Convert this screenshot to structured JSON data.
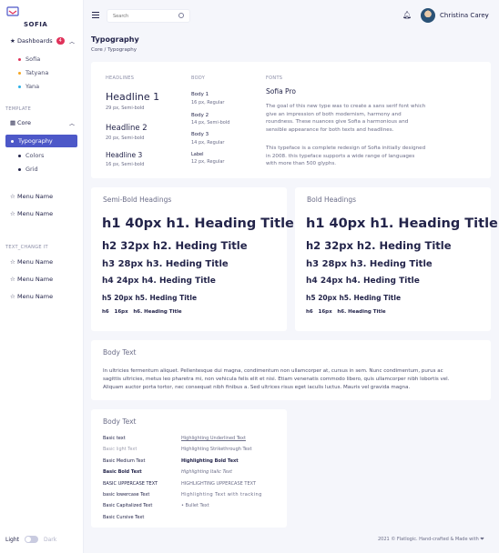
{
  "sidebar": {
    "brand": "SOFIA",
    "dashboards": {
      "label": "Dashboards",
      "badge": "4"
    },
    "dash_items": [
      {
        "label": "Sofia",
        "color": "#e0325a"
      },
      {
        "label": "Tatyana",
        "color": "#f5a623"
      },
      {
        "label": "Yana",
        "color": "#2ab0e8"
      }
    ],
    "template_title": "TEMPLATE",
    "core": {
      "label": "Core"
    },
    "core_items": [
      "Typography",
      "Colors",
      "Grid"
    ],
    "menu_items_a": [
      "Menu Name",
      "Menu Name"
    ],
    "text_change_title": "TEXT_CHANGE IT",
    "menu_items_b": [
      "Menu Name",
      "Menu Name",
      "Menu Name"
    ],
    "theme": {
      "light": "Light",
      "dark": "Dark"
    }
  },
  "header": {
    "search_placeholder": "Search",
    "user_name": "Christina Carey"
  },
  "page": {
    "title": "Typography",
    "breadcrumb": "Core  /  Typography"
  },
  "fonts_card": {
    "headlines_label": "HEADLINES",
    "body_label": "BODY",
    "fonts_label": "FONTS",
    "headlines": [
      {
        "name": "Headline 1",
        "meta": "29 px, Semi-bold"
      },
      {
        "name": "Headline 2",
        "meta": "20 px, Semi-bold"
      },
      {
        "name": "Headline 3",
        "meta": "16 px, Semi-bold"
      }
    ],
    "bodies": [
      {
        "name": "Body 1",
        "meta": "16 px, Regular"
      },
      {
        "name": "Body 2",
        "meta": "14 px, Semi-bold"
      },
      {
        "name": "Body 3",
        "meta": "14 px, Regular"
      },
      {
        "name": "Label",
        "meta": "12 px, Regular"
      }
    ],
    "font_name": "Sofia Pro",
    "para1": [
      "The goal of this new type was to create a sans serif font which",
      "give an impression of both modernism, harmony and",
      "roundness. These nuances give Sofia a harmonious and",
      "sensible appearance for both texts and headlines."
    ],
    "para2": [
      "This typeface is a complete redesign of Sofia initially designed",
      "in 2008. this typeface supports a wide range of languages",
      "with more than 500 glyphs."
    ]
  },
  "semibold": {
    "title": "Semi-Bold Headings",
    "rows": [
      {
        "tag": "h1",
        "size": "40px",
        "text": "h1. Heading Title"
      },
      {
        "tag": "h2",
        "size": "32px",
        "text": "h2. Heding Title"
      },
      {
        "tag": "h3",
        "size": "28px",
        "text": "h3. Heding Title"
      },
      {
        "tag": "h4",
        "size": "24px",
        "text": "h4. Heding Title"
      },
      {
        "tag": "h5",
        "size": "20px",
        "text": "h5. Heding Title"
      },
      {
        "tag": "h6",
        "size": "16px",
        "text": "h6. Heading Title"
      }
    ]
  },
  "bold": {
    "title": "Bold Headings",
    "rows": [
      {
        "tag": "h1",
        "size": "40px",
        "text": "h1. Heading Title"
      },
      {
        "tag": "h2",
        "size": "32px",
        "text": "h2. Heding Title"
      },
      {
        "tag": "h3",
        "size": "28px",
        "text": "h3. Heding Title"
      },
      {
        "tag": "h4",
        "size": "24px",
        "text": "h4. Heding Title"
      },
      {
        "tag": "h5",
        "size": "20px",
        "text": "h5. Heding Title"
      },
      {
        "tag": "h6",
        "size": "16px",
        "text": "h6. Heading Title"
      }
    ]
  },
  "bodytext": {
    "title": "Body Text",
    "lines": [
      "In ultricies fermentum aliquet. Pellentesque dui magna, condimentum non ullamcorper at, cursus in sem. Nunc condimentum, purus ac",
      "sagittis ultricies, metus leo pharetra mi, non vehicula felis elit et nisi. Etiam venenatis commodo libero, quis ullamcorper nibh lobortis vel.",
      "Aliquam auctor porta tortor, nec consequat nibh finibus a. Sed ultrices risus eget iaculis luctus. Mauris vel gravida magna."
    ]
  },
  "bodytext2": {
    "title": "Body Text",
    "left": [
      "Basic text",
      "Basic light Text",
      "Basic Medium Text",
      "Basic Bold Text",
      "BASIC UPPERCASE TEXT",
      "basic lowercase Text",
      "Basic Capitalized Text",
      "Basic Cursive Text"
    ],
    "right": [
      "Highlighting Underlined Text",
      "Highlighting Strikethrough Text",
      "Highlighting Bold Text",
      "Highlighting Italic Text",
      "HIGHLIGHTING UPPERCASE TEXT",
      "Highlighting Text with tracking",
      "Bullet Text"
    ]
  },
  "footer": {
    "text": "2021 © Flatlogic. Hand-crafted & Made with ❤"
  }
}
